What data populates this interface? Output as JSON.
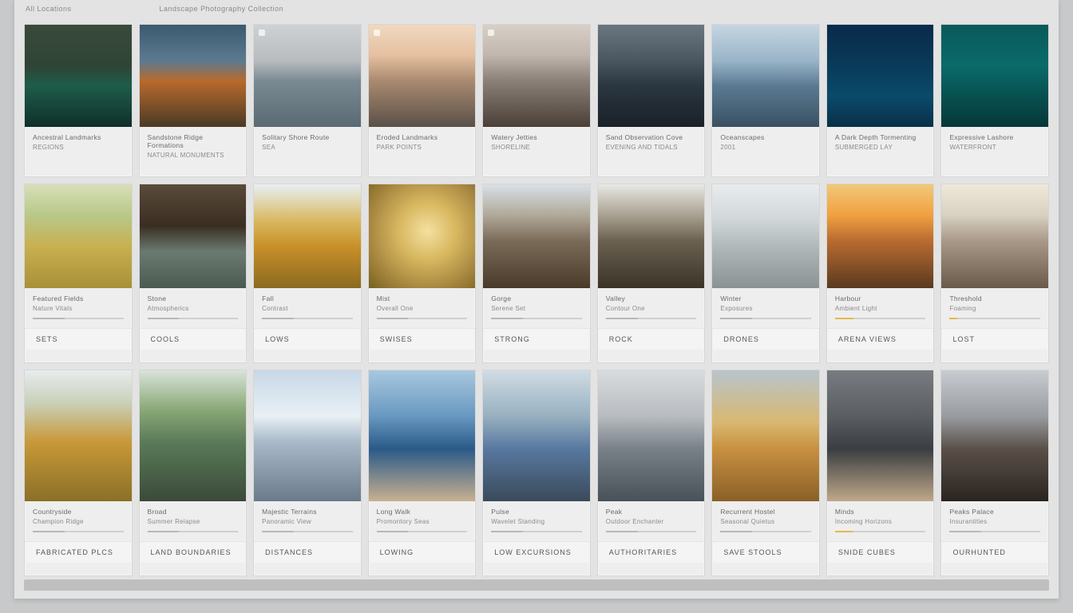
{
  "header": {
    "left": "All Locations",
    "right": "Landscape Photography Collection"
  },
  "rows": [
    [
      {
        "title": "Ancestral Landmarks",
        "sub": "REGIONS",
        "code": "",
        "thumb": "t-forest-lake"
      },
      {
        "title": "Sandstone Ridge Formations",
        "sub": "NATURAL MONUMENTS",
        "code": "",
        "thumb": "t-orange-rock"
      },
      {
        "title": "Solitary Shore Route",
        "sub": "SEA",
        "code": "",
        "thumb": "t-grey-sea"
      },
      {
        "title": "Eroded Landmarks",
        "sub": "PARK POINTS",
        "code": "",
        "thumb": "t-sunset-cliff"
      },
      {
        "title": "Watery Jetties",
        "sub": "SHORELINE",
        "code": "",
        "thumb": "t-dusk-water"
      },
      {
        "title": "Sand Observation Cove",
        "sub": "EVENING AND TIDALS",
        "code": "",
        "thumb": "t-dark-island"
      },
      {
        "title": "Oceanscapes",
        "sub": "2001",
        "code": "",
        "thumb": "t-blue-island"
      },
      {
        "title": "A Dark Depth Tormenting",
        "sub": "SUBMERGED LAY",
        "code": "",
        "thumb": "t-deep-blue"
      },
      {
        "title": "Expressive Lashore",
        "sub": "WATERFRONT",
        "code": "",
        "thumb": "t-teal"
      }
    ],
    [
      {
        "title": "Featured Fields",
        "sub": "Nature Vitals",
        "code": "SETS",
        "thumb": "t-meadow"
      },
      {
        "title": "Stone",
        "sub": "Atmospherics",
        "code": "COOLS",
        "thumb": "t-cave"
      },
      {
        "title": "Fall",
        "sub": "Contrast",
        "code": "LOWS",
        "thumb": "t-autumn"
      },
      {
        "title": "Mist",
        "sub": "Overall One",
        "code": "SWISES",
        "thumb": "t-gold-mist"
      },
      {
        "title": "Gorge",
        "sub": "Serene Set",
        "code": "STRONG",
        "thumb": "t-canyon"
      },
      {
        "title": "Valley",
        "sub": "Contour One",
        "code": "ROCK",
        "thumb": "t-valley-river"
      },
      {
        "title": "Winter",
        "sub": "Exposures",
        "code": "DRONES",
        "thumb": "t-ice-coast"
      },
      {
        "title": "Harbour",
        "sub": "Ambient Light",
        "code": "ARENA VIEWS",
        "thumb": "t-sunset-sea"
      },
      {
        "title": "Threshold",
        "sub": "Foaming",
        "code": "LOST",
        "thumb": "t-beach-dawn"
      }
    ],
    [
      {
        "title": "Countryside",
        "sub": "Champion Ridge",
        "code": "FABRICATED PLCS",
        "thumb": "t-oak-hill"
      },
      {
        "title": "Broad",
        "sub": "Summer Relapse",
        "code": "LAND BOUNDARIES",
        "thumb": "t-green-stream"
      },
      {
        "title": "Majestic Terrains",
        "sub": "Panoramic View",
        "code": "DISTANCES",
        "thumb": "t-snow-peaks"
      },
      {
        "title": "Long Walk",
        "sub": "Promontory Seas",
        "code": "LOWING",
        "thumb": "t-blue-lagoon"
      },
      {
        "title": "Pulse",
        "sub": "Wavelet Standing",
        "code": "LOW EXCURSIONS",
        "thumb": "t-ocean-rocks"
      },
      {
        "title": "Peak",
        "sub": "Outdoor Enchanter",
        "code": "AUTHORITARIES",
        "thumb": "t-cloudy-peak"
      },
      {
        "title": "Recurrent Hostel",
        "sub": "Seasonal Quietus",
        "code": "SAVE STOOLS",
        "thumb": "t-autumn-falls"
      },
      {
        "title": "Minds",
        "sub": "Incoming Horizons",
        "code": "SNIDE CUBES",
        "thumb": "t-storm-shore"
      },
      {
        "title": "Peaks Palace",
        "sub": "Insurantities",
        "code": "OURHUNTED",
        "thumb": "t-dusk-mound"
      }
    ]
  ]
}
